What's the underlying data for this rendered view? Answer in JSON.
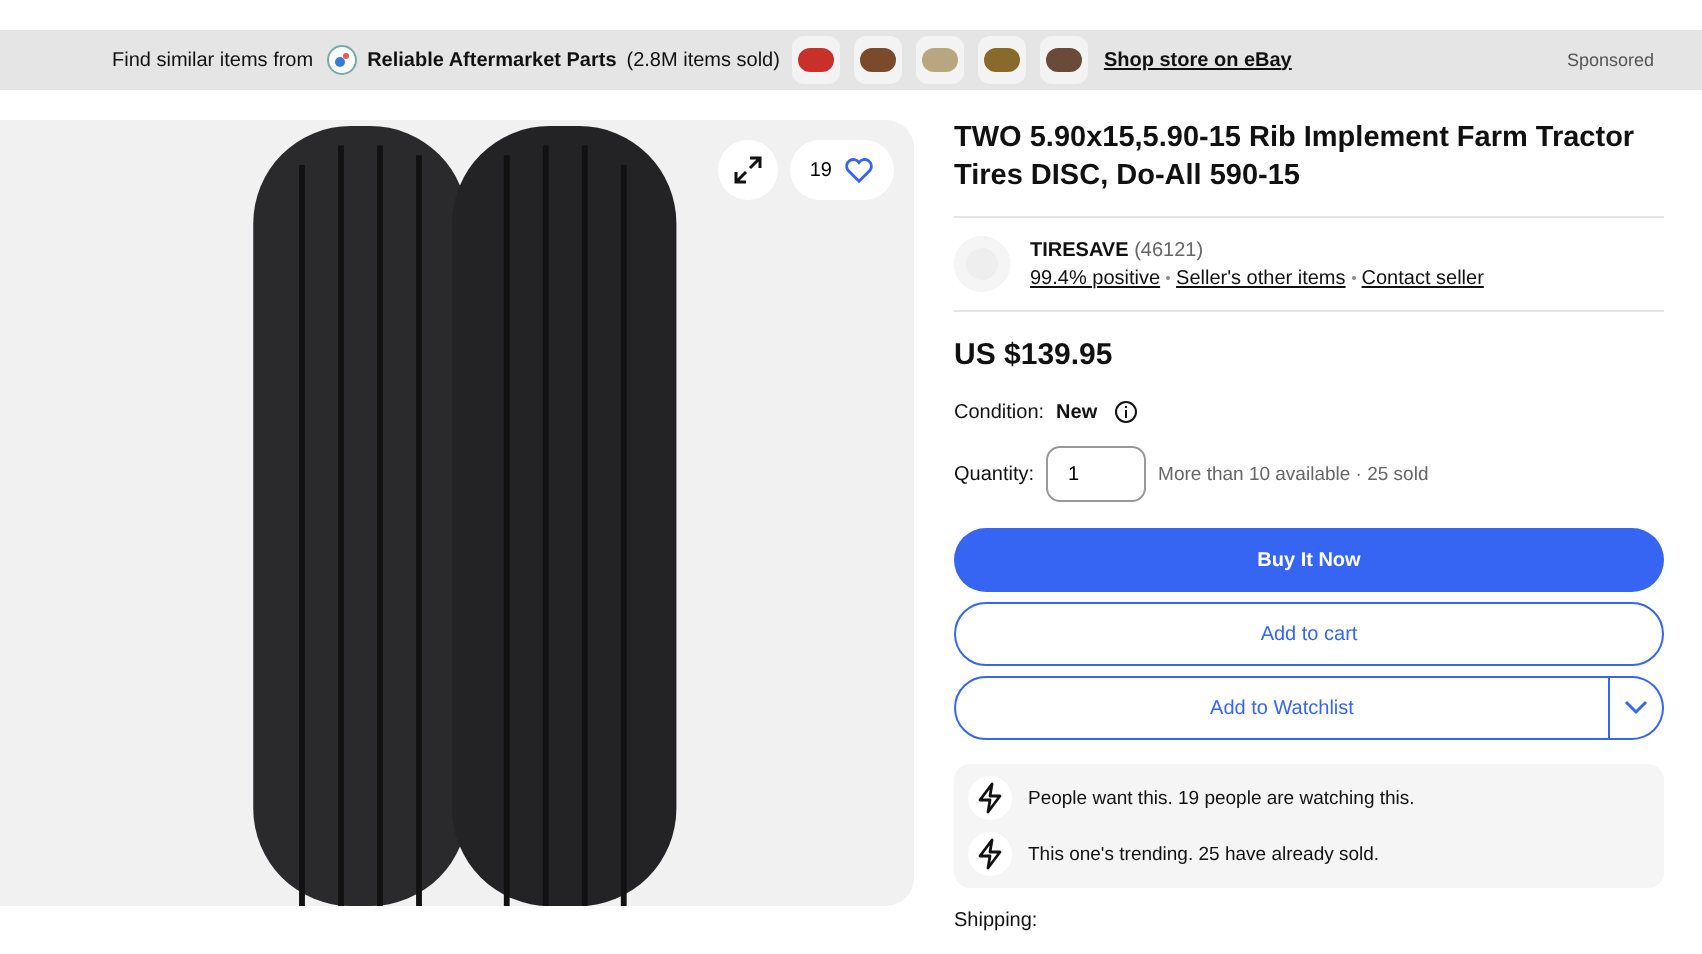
{
  "banner": {
    "lead": "Find similar items from",
    "store": "Reliable Aftermarket Parts",
    "sold": "(2.8M items sold)",
    "link": "Shop store on eBay",
    "sponsored": "Sponsored"
  },
  "gallery": {
    "watch_count": "19"
  },
  "title": "TWO 5.90x15,5.90-15 Rib Implement Farm Tractor Tires DISC, Do-All 590-15",
  "seller": {
    "name": "TIRESAVE",
    "score": "(46121)",
    "positive": "99.4% positive",
    "other_items": "Seller's other items",
    "contact": "Contact seller"
  },
  "price": "US $139.95",
  "condition": {
    "label": "Condition:",
    "value": "New"
  },
  "quantity": {
    "label": "Quantity:",
    "value": "1",
    "availability": "More than 10 available · 25 sold"
  },
  "buttons": [
    {
      "label": "Buy It Now",
      "kind": "primary"
    },
    {
      "label": "Add to cart",
      "kind": "secondary"
    },
    {
      "label": "Add to Watchlist",
      "kind": "split"
    }
  ],
  "signals": [
    "People want this. 19 people are watching this.",
    "This one's trending. 25 have already sold."
  ],
  "shipping_label": "Shipping:"
}
